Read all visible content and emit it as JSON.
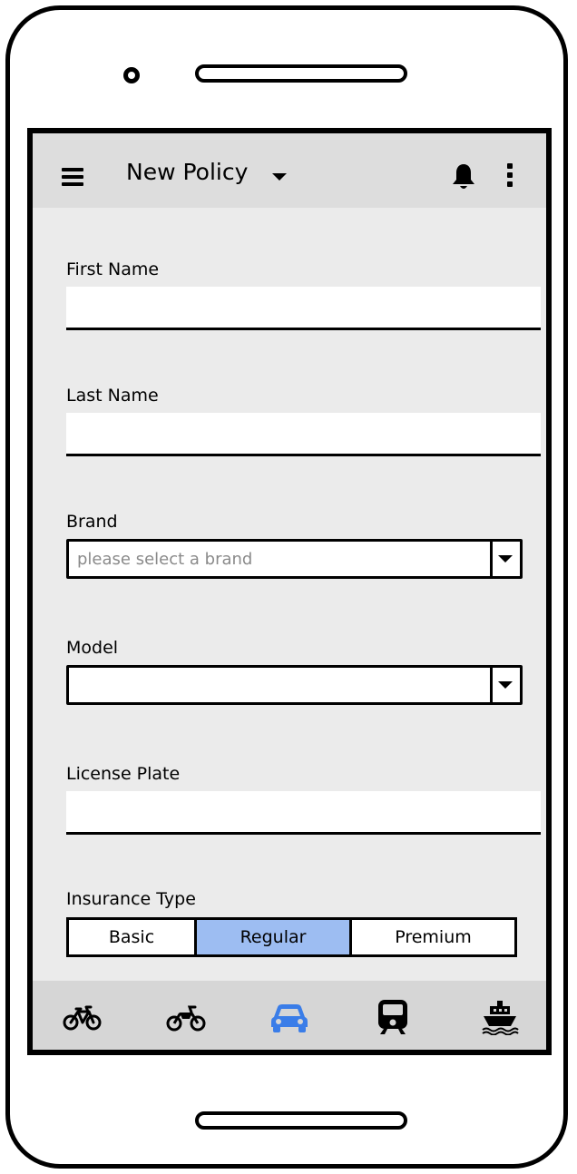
{
  "header": {
    "title": "New Policy",
    "icons": {
      "menu": "hamburger-menu-icon",
      "title_dropdown": "caret-down-icon",
      "notifications": "bell-icon",
      "overflow": "more-vertical-icon"
    }
  },
  "form": {
    "first_name": {
      "label": "First Name",
      "value": ""
    },
    "last_name": {
      "label": "Last Name",
      "value": ""
    },
    "brand": {
      "label": "Brand",
      "placeholder": "please select a brand",
      "value": ""
    },
    "model": {
      "label": "Model",
      "value": ""
    },
    "license_plate": {
      "label": "License Plate",
      "value": ""
    },
    "insurance_type": {
      "label": "Insurance Type",
      "options": [
        "Basic",
        "Regular",
        "Premium"
      ],
      "selected": "Regular"
    }
  },
  "bottom_nav": {
    "items": [
      {
        "icon": "bicycle-icon",
        "active": false
      },
      {
        "icon": "motorcycle-icon",
        "active": false
      },
      {
        "icon": "car-icon",
        "active": true
      },
      {
        "icon": "train-icon",
        "active": false
      },
      {
        "icon": "ship-icon",
        "active": false
      }
    ],
    "active_color": "#3a7de8"
  },
  "colors": {
    "appbar": "#dddddd",
    "screen_bg": "#ebebeb",
    "segment_selected": "#9dbdf2",
    "bottom_nav_bg": "#d6d6d6"
  }
}
